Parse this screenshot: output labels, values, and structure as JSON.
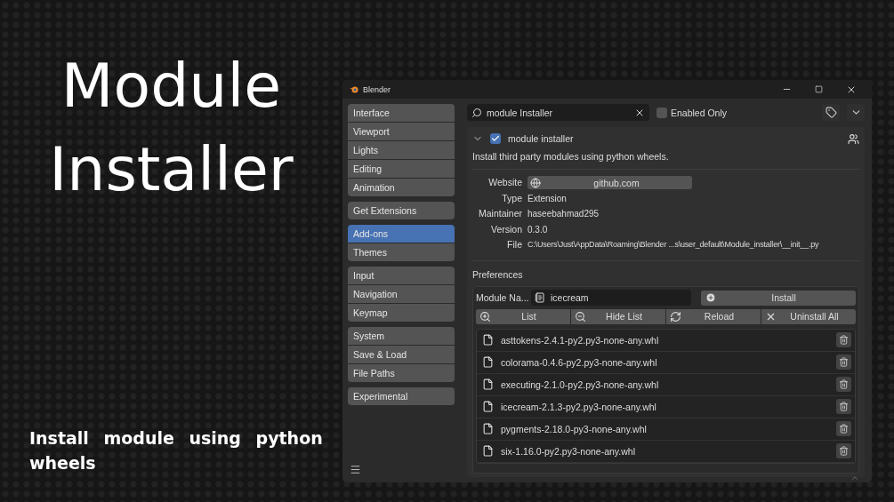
{
  "poster": {
    "title": "Module Installer",
    "subtitle": "Install module using python wheels"
  },
  "window": {
    "title": "Blender"
  },
  "sidebar": {
    "groups": [
      [
        {
          "label": "Interface",
          "selected": false
        },
        {
          "label": "Viewport",
          "selected": false
        },
        {
          "label": "Lights",
          "selected": false
        },
        {
          "label": "Editing",
          "selected": false
        },
        {
          "label": "Animation",
          "selected": false
        }
      ],
      [
        {
          "label": "Get Extensions",
          "selected": false
        }
      ],
      [
        {
          "label": "Add-ons",
          "selected": true
        },
        {
          "label": "Themes",
          "selected": false
        }
      ],
      [
        {
          "label": "Input",
          "selected": false
        },
        {
          "label": "Navigation",
          "selected": false
        },
        {
          "label": "Keymap",
          "selected": false
        }
      ],
      [
        {
          "label": "System",
          "selected": false
        },
        {
          "label": "Save & Load",
          "selected": false
        },
        {
          "label": "File Paths",
          "selected": false
        }
      ],
      [
        {
          "label": "Experimental",
          "selected": false
        }
      ]
    ]
  },
  "search": {
    "value": "module Installer"
  },
  "enabled_only": {
    "label": "Enabled Only",
    "checked": false
  },
  "addon": {
    "name": "module installer",
    "expanded": true,
    "enabled": true,
    "description": "Install third party modules using python wheels.",
    "details": [
      {
        "label": "Website",
        "value": "github.com",
        "kind": "link"
      },
      {
        "label": "Type",
        "value": "Extension",
        "kind": "text"
      },
      {
        "label": "Maintainer",
        "value": "haseebahmad295",
        "kind": "text"
      },
      {
        "label": "Version",
        "value": "0.3.0",
        "kind": "text"
      },
      {
        "label": "File",
        "value": "C:\\Users\\Just\\AppData\\Roaming\\Blender ...s\\user_default\\Module_installer\\__init__.py",
        "kind": "text"
      }
    ]
  },
  "preferences": {
    "title": "Preferences",
    "module_name": {
      "label": "Module Na...",
      "value": "icecream"
    },
    "install": "Install",
    "actions": [
      {
        "label": "List"
      },
      {
        "label": "Hide List"
      },
      {
        "label": "Reload"
      },
      {
        "label": "Uninstall All"
      }
    ],
    "files": [
      "asttokens-2.4.1-py2.py3-none-any.whl",
      "colorama-0.4.6-py2.py3-none-any.whl",
      "executing-2.1.0-py2.py3-none-any.whl",
      "icecream-2.1.3-py2.py3-none-any.whl",
      "pygments-2.18.0-py3-none-any.whl",
      "six-1.16.0-py2.py3-none-any.whl"
    ]
  }
}
